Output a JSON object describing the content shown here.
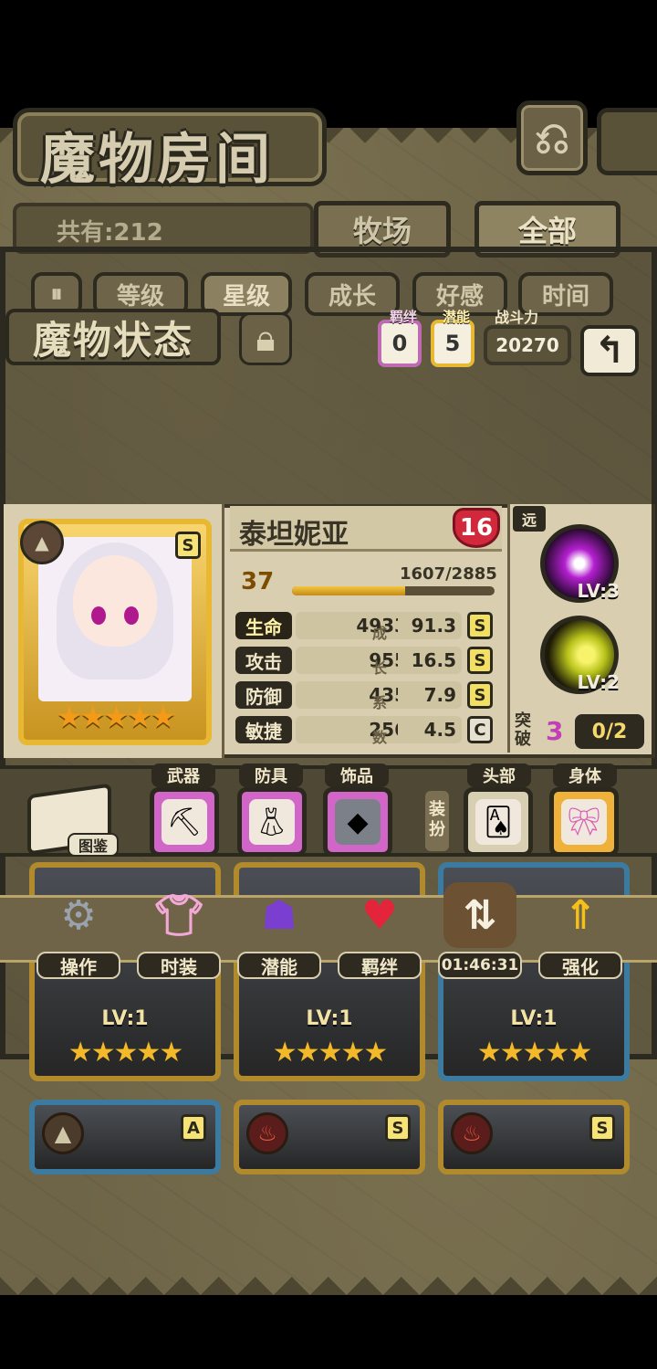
{
  "header": {
    "title": "魔物房间",
    "back_icon": "return-arrow-icon"
  },
  "collection": {
    "count_label": "共有:212",
    "tabs": [
      "牧场",
      "全部"
    ],
    "active_tab": "全部"
  },
  "sort": {
    "toggle_icon": "pause-sort-icon",
    "options": [
      "等级",
      "星级",
      "成长",
      "好感",
      "时间"
    ],
    "active": "星级"
  },
  "status_panel": {
    "title": "魔物状态",
    "lock_icon": "lock-icon",
    "bond": {
      "label": "羁绊",
      "value": "0"
    },
    "potential": {
      "label": "潜能",
      "value": "5"
    },
    "power": {
      "label": "战斗力",
      "value": "20270"
    },
    "back_label": "↰"
  },
  "monster": {
    "name": "泰坦妮亚",
    "rank": "16",
    "grade": "S",
    "level": "37",
    "xp": "1607/2885",
    "xp_ratio": 0.557,
    "stars": "★★★★★",
    "stats": [
      {
        "label": "生命",
        "value": "4933",
        "growth": "91.3",
        "grade": "S",
        "highlight": true
      },
      {
        "label": "攻击",
        "value": "955",
        "growth": "16.5",
        "grade": "S",
        "highlight": false
      },
      {
        "label": "防御",
        "value": "435",
        "growth": "7.9",
        "grade": "S",
        "highlight": false
      },
      {
        "label": "敏捷",
        "value": "256",
        "growth": "4.5",
        "grade": "C",
        "highlight": false
      }
    ],
    "growth_chars": [
      "成",
      "长",
      "系",
      "数"
    ],
    "range": "远",
    "skills": [
      {
        "name": "purple-burst-skill-icon",
        "level": "LV:3"
      },
      {
        "name": "yellow-wave-skill-icon",
        "level": "LV:2"
      }
    ],
    "breakthrough": {
      "label": "突破",
      "value": "3",
      "progress": "0/2"
    }
  },
  "equipment": {
    "book_label": "图鉴",
    "slots": [
      {
        "label": "武器",
        "icon": "pickaxe-icon"
      },
      {
        "label": "防具",
        "icon": "dress-armor-icon"
      },
      {
        "label": "饰品",
        "icon": "rune-stone-icon"
      }
    ],
    "dress_label": "装扮",
    "appearance": [
      {
        "label": "头部",
        "icon": "card-hairpin-icon"
      },
      {
        "label": "身体",
        "icon": "bow-icon"
      }
    ]
  },
  "actions": [
    {
      "label": "操作",
      "icon": "gears-icon"
    },
    {
      "label": "时装",
      "icon": "outfit-icon"
    },
    {
      "label": "潜能",
      "icon": "demon-potential-icon"
    },
    {
      "label": "羁绊",
      "icon": "hearts-bond-icon"
    },
    {
      "label": "01:46:31",
      "icon": "swap-chest-icon"
    },
    {
      "label": "强化",
      "icon": "arrows-upgrade-icon"
    }
  ],
  "cards": [
    {
      "level": "LV:1",
      "stars": "★★★★★"
    },
    {
      "level": "LV:1",
      "stars": "★★★★★"
    },
    {
      "level": "LV:1",
      "stars": "★★★★★"
    }
  ],
  "bottom_cards": [
    {
      "grade": "A"
    },
    {
      "grade": "S"
    },
    {
      "grade": "S"
    }
  ]
}
